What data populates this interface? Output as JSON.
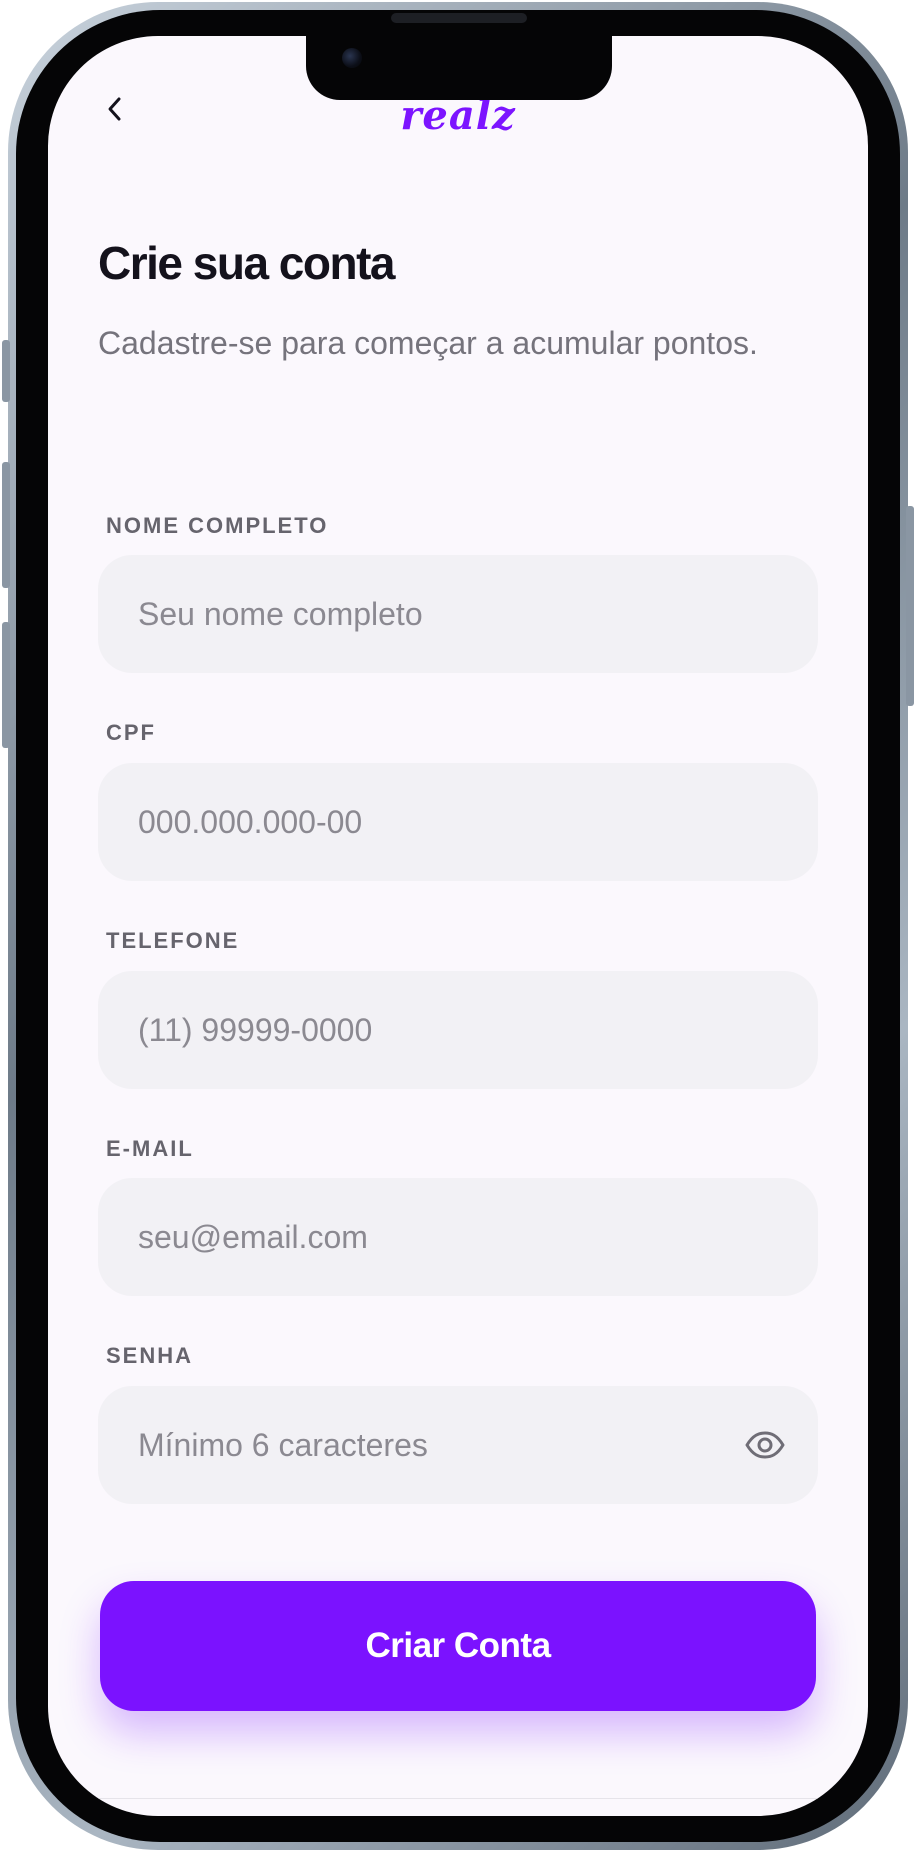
{
  "header": {
    "brand_logo": "realz",
    "back_icon": "chevron-left-icon"
  },
  "page": {
    "title": "Crie sua conta",
    "subtitle": "Cadastre-se para começar a acumular pontos."
  },
  "form": {
    "name": {
      "label": "NOME COMPLETO",
      "placeholder": "Seu nome completo",
      "value": ""
    },
    "cpf": {
      "label": "CPF",
      "placeholder": "000.000.000-00",
      "value": ""
    },
    "phone": {
      "label": "TELEFONE",
      "placeholder": "(11) 99999-0000",
      "value": ""
    },
    "email": {
      "label": "E-MAIL",
      "placeholder": "seu@email.com",
      "value": ""
    },
    "password": {
      "label": "SENHA",
      "placeholder": "Mínimo 6 caracteres",
      "value": "",
      "toggle_icon": "eye-icon"
    }
  },
  "actions": {
    "submit_label": "Criar Conta"
  },
  "colors": {
    "brand": "#7b12ff",
    "background": "#fbf8fd",
    "field_background": "#f2f1f5",
    "title_text": "#14121c",
    "label_text": "#66646d",
    "placeholder_text": "#8b8991"
  }
}
